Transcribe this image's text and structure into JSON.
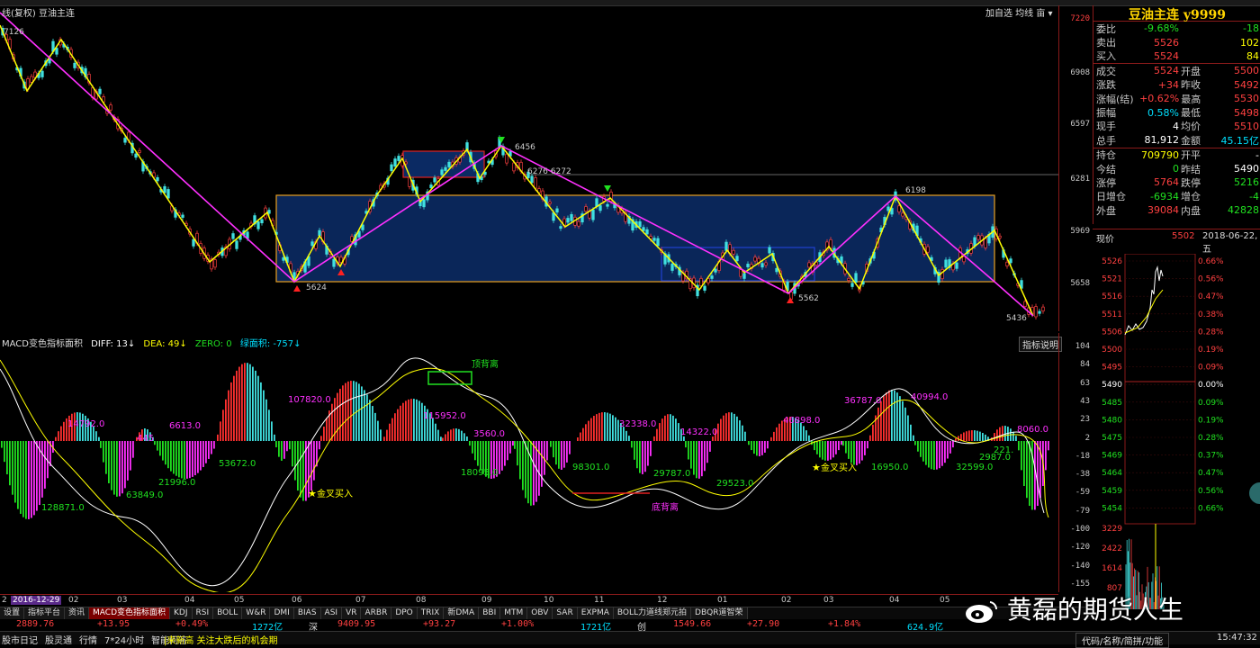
{
  "window": {
    "title_left": "线(复权)  豆油主连",
    "tools": "加自选  均线  亩  ▾"
  },
  "main_axis_labels": [
    "7220",
    "6908",
    "6597",
    "6281",
    "5969",
    "5658"
  ],
  "main_annotations": {
    "high_label": "7126",
    "peak": "6456",
    "range": "6276  6272",
    "right_peak": "6198",
    "low1": "5624",
    "low2": "5562",
    "last_low": "5436"
  },
  "macd": {
    "title": "MACD变色指标面积",
    "diff": "DIFF: 13↓",
    "dea": "DEA: 49↓",
    "zero": "ZERO: 0",
    "area": "绿面积: -757↓",
    "indicator_button": "指标说明",
    "axis_labels": [
      "104",
      "84",
      "63",
      "43",
      "23",
      "2",
      "-18",
      "-38",
      "-59",
      "-79",
      "-100",
      "-120",
      "-140",
      "-155"
    ],
    "annotations": {
      "top_div": "顶背离",
      "bottom_div": "底背离",
      "golden1": "金叉买入",
      "golden2": "金叉买入",
      "v1": "14792.0",
      "v2": "6613.0",
      "v3": "107820.0",
      "v4": "115952.0",
      "v5": "3560.0",
      "v6": "32338.0",
      "v7": "14322.0",
      "v8": "46898.0",
      "v9": "36787.0",
      "v10": "40994.0",
      "v11": "8060.0",
      "n1": "128871.0",
      "n2": "63849.0",
      "n3": "21996.0",
      "n4": "53672.0",
      "n5": "18095.0",
      "n6": "98301.0",
      "n7": "29787.0",
      "n8": "29523.0",
      "n9": "16950.0",
      "n10": "32599.0",
      "n11": "2987.0",
      "n12": "221.",
      "small1": "445"
    }
  },
  "xaxis": {
    "first": "2",
    "date": "2016-12-29",
    "labels": [
      "02",
      "03",
      "04",
      "05",
      "06",
      "07",
      "08",
      "09",
      "10",
      "11",
      "12",
      "01",
      "02",
      "03",
      "04",
      "05"
    ]
  },
  "tabs": [
    "设置",
    "指标平台",
    "资讯",
    "MACD变色指标面积",
    "KDJ",
    "RSI",
    "BOLL",
    "W&R",
    "DMI",
    "BIAS",
    "ASI",
    "VR",
    "ARBR",
    "DPO",
    "TRIX",
    "新DMA",
    "BBI",
    "MTM",
    "OBV",
    "SAR",
    "EXPMA",
    "BOLL力道线郑元拍",
    "DBQR道智荣"
  ],
  "index_bar": {
    "sh_value": "2889.76",
    "sh_change": "+13.95",
    "sh_pct": "+0.49%",
    "sh_amount": "1272亿",
    "sz_label": "深",
    "sz_value": "9409.95",
    "sz_change": "+93.27",
    "sz_pct": "+1.00%",
    "sz_amount": "1721亿",
    "cy_label": "创",
    "cy_value": "1549.66",
    "cy_change": "+27.90",
    "cy_pct": "+1.84%",
    "cy_amount": "624.9亿"
  },
  "status_bar": {
    "items": [
      "股市日记",
      "股灵通",
      "行情",
      "7*24小时",
      "智能问答"
    ],
    "news": "|来新高 关注大跌后的机会期",
    "right": "代码/名称/简拼/功能",
    "time": "15:47:32"
  },
  "quote": {
    "title": "豆油主连 y9999",
    "rows": [
      {
        "l": "委比",
        "v": "-9.68%",
        "vc": "green",
        "l2": "",
        "v2": "-18",
        "v2c": "green"
      },
      {
        "l": "卖出",
        "v": "5526",
        "vc": "red",
        "l2": "",
        "v2": "102",
        "v2c": "yellow"
      },
      {
        "l": "买入",
        "v": "5524",
        "vc": "red",
        "l2": "",
        "v2": "84",
        "v2c": "yellow"
      },
      {
        "l": "成交",
        "v": "5524",
        "vc": "red",
        "l2": "开盘",
        "v2": "5500",
        "v2c": "red"
      },
      {
        "l": "涨跌",
        "v": "+34",
        "vc": "red",
        "l2": "昨收",
        "v2": "5492",
        "v2c": "red"
      },
      {
        "l": "涨幅(结)",
        "v": "+0.62%",
        "vc": "red",
        "l2": "最高",
        "v2": "5530",
        "v2c": "red"
      },
      {
        "l": "振幅",
        "v": "0.58%",
        "vc": "cyan",
        "l2": "最低",
        "v2": "5498",
        "v2c": "red"
      },
      {
        "l": "现手",
        "v": "4",
        "vc": "white",
        "l2": "均价",
        "v2": "5510",
        "v2c": "red"
      },
      {
        "l": "总手",
        "v": "81,912",
        "vc": "white",
        "l2": "金额",
        "v2": "45.15亿",
        "v2c": "cyan"
      },
      {
        "l": "持仓",
        "v": "709790",
        "vc": "yellow",
        "l2": "开平",
        "v2": "-",
        "v2c": "white"
      },
      {
        "l": "今结",
        "v": "0",
        "vc": "green",
        "l2": "昨结",
        "v2": "5490",
        "v2c": "white"
      },
      {
        "l": "涨停",
        "v": "5764",
        "vc": "red",
        "l2": "跌停",
        "v2": "5216",
        "v2c": "green"
      },
      {
        "l": "日增仓",
        "v": "-6934",
        "vc": "green",
        "l2": "增仓",
        "v2": "-4",
        "v2c": "green"
      },
      {
        "l": "外盘",
        "v": "39084",
        "vc": "red",
        "l2": "内盘",
        "v2": "42828",
        "v2c": "green"
      }
    ]
  },
  "tick": {
    "label": "现价",
    "price": "5502",
    "date": "2018-06-22,五",
    "left_axis": [
      "5526",
      "5521",
      "5516",
      "5511",
      "5506",
      "5500",
      "5495",
      "5490",
      "5485",
      "5480",
      "5475",
      "5469",
      "5464",
      "5459",
      "5454"
    ],
    "right_axis": [
      "0.66%",
      "0.56%",
      "0.47%",
      "0.38%",
      "0.28%",
      "0.19%",
      "0.09%",
      "0.00%",
      "0.09%",
      "0.19%",
      "0.28%",
      "0.37%",
      "0.47%",
      "0.56%",
      "0.66%"
    ],
    "vol_axis": [
      "3229",
      "2422",
      "1614",
      "807"
    ]
  },
  "watermark": {
    "text": "黄磊的期货人生"
  }
}
